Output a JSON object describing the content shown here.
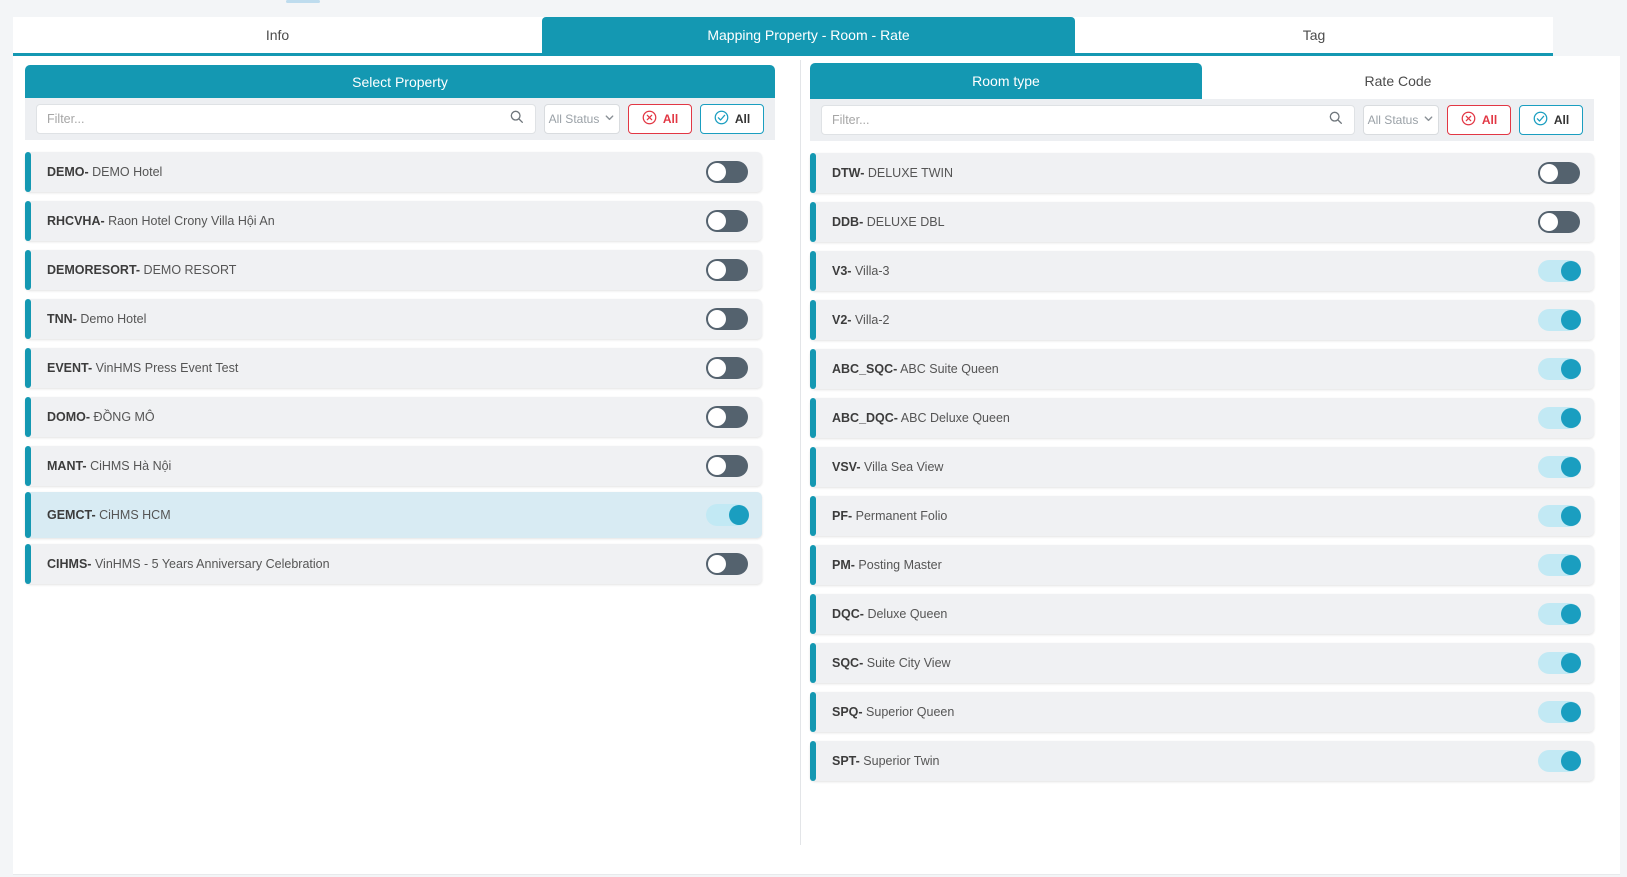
{
  "tabs": [
    {
      "id": "info",
      "label": "Info",
      "active": false
    },
    {
      "id": "mapping-property-room-rate",
      "label": "Mapping Property - Room - Rate",
      "active": true
    },
    {
      "id": "tag",
      "label": "Tag",
      "active": false
    }
  ],
  "left_panel": {
    "header": "Select Property",
    "filter": {
      "placeholder": "Filter...",
      "value": ""
    },
    "status_filter": {
      "selected": "All Status"
    },
    "buttons": {
      "deselect_all": "All",
      "select_all": "All"
    },
    "items": [
      {
        "code": "DEMO-",
        "name": "DEMO Hotel",
        "on": false,
        "selected": false
      },
      {
        "code": "RHCVHA-",
        "name": "Raon Hotel Crony Villa Hội An",
        "on": false,
        "selected": false
      },
      {
        "code": "DEMORESORT-",
        "name": "DEMO RESORT",
        "on": false,
        "selected": false
      },
      {
        "code": "TNN-",
        "name": "Demo Hotel",
        "on": false,
        "selected": false
      },
      {
        "code": "EVENT-",
        "name": "VinHMS Press Event Test",
        "on": false,
        "selected": false
      },
      {
        "code": "DOMO-",
        "name": "ĐỒNG MÔ",
        "on": false,
        "selected": false
      },
      {
        "code": "MANT-",
        "name": "CiHMS Hà Nội",
        "on": false,
        "selected": false
      },
      {
        "code": "GEMCT-",
        "name": "CiHMS HCM",
        "on": true,
        "selected": true
      },
      {
        "code": "CIHMS-",
        "name": "VinHMS - 5 Years Anniversary Celebration",
        "on": false,
        "selected": false
      }
    ]
  },
  "right_panel": {
    "tabs": [
      {
        "id": "room-type",
        "label": "Room type",
        "active": true
      },
      {
        "id": "rate-code",
        "label": "Rate Code",
        "active": false
      }
    ],
    "filter": {
      "placeholder": "Filter...",
      "value": ""
    },
    "status_filter": {
      "selected": "All Status"
    },
    "buttons": {
      "deselect_all": "All",
      "select_all": "All"
    },
    "items": [
      {
        "code": "DTW-",
        "name": "DELUXE TWIN",
        "on": false,
        "selected": false
      },
      {
        "code": "DDB-",
        "name": "DELUXE DBL",
        "on": false,
        "selected": false
      },
      {
        "code": "V3-",
        "name": "Villa-3",
        "on": true,
        "selected": false
      },
      {
        "code": "V2-",
        "name": "Villa-2",
        "on": true,
        "selected": false
      },
      {
        "code": "ABC_SQC-",
        "name": "ABC Suite Queen",
        "on": true,
        "selected": false
      },
      {
        "code": "ABC_DQC-",
        "name": "ABC Deluxe Queen",
        "on": true,
        "selected": false
      },
      {
        "code": "VSV-",
        "name": "Villa Sea View",
        "on": true,
        "selected": false
      },
      {
        "code": "PF-",
        "name": "Permanent Folio",
        "on": true,
        "selected": false
      },
      {
        "code": "PM-",
        "name": "Posting Master",
        "on": true,
        "selected": false
      },
      {
        "code": "DQC-",
        "name": "Deluxe Queen",
        "on": true,
        "selected": false
      },
      {
        "code": "SQC-",
        "name": "Suite City View",
        "on": true,
        "selected": false
      },
      {
        "code": "SPQ-",
        "name": "Superior Queen",
        "on": true,
        "selected": false
      },
      {
        "code": "SPT-",
        "name": "Superior Twin",
        "on": true,
        "selected": false
      }
    ]
  },
  "icons": {
    "search": "search-icon",
    "status_chevron": "chevron-down-icon",
    "deselect_all": "x-circle-icon",
    "select_all": "check-circle-icon"
  },
  "colors": {
    "accent_teal": "#1498b2",
    "danger_red": "#e23744",
    "toggle_off": "#54626e",
    "toggle_on_track": "#c2e9f4",
    "toggle_on_knob": "#1a9ec0",
    "selected_row_bg": "#d8ebf3",
    "row_bg": "#f0f1f3",
    "page_bg": "#f3f5f7"
  }
}
